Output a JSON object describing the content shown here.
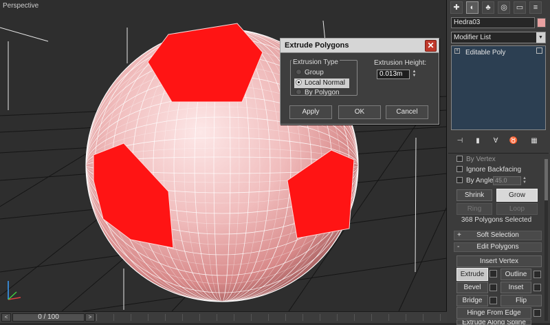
{
  "viewport": {
    "label": "Perspective"
  },
  "timeline": {
    "frame_text": "0 / 100",
    "prev_symbol": "<",
    "next_symbol": ">"
  },
  "dialog": {
    "title": "Extrude Polygons",
    "close_symbol": "✕",
    "extrusion_type_label": "Extrusion Type",
    "options": [
      "Group",
      "Local Normal",
      "By Polygon"
    ],
    "selected_option": "Local Normal",
    "extrusion_height_label": "Extrusion Height:",
    "extrusion_height_value": "0.013m",
    "buttons": {
      "apply": "Apply",
      "ok": "OK",
      "cancel": "Cancel"
    }
  },
  "panel": {
    "tabs": [
      "create-icon",
      "modify-icon",
      "hierarchy-icon",
      "motion-icon",
      "display-icon",
      "utilities-icon"
    ],
    "object_name": "Hedra03",
    "object_color": "#e8a0a0",
    "modifier_list_label": "Modifier List",
    "stack_items": [
      "Editable Poly"
    ],
    "selection": {
      "by_vertex_label": "By Vertex",
      "ignore_backfacing_label": "Ignore Backfacing",
      "by_angle_label": "By Angle:",
      "by_angle_value": "45.0",
      "shrink_label": "Shrink",
      "grow_label": "Grow",
      "ring_label": "Ring",
      "loop_label": "Loop",
      "selected_info": "368 Polygons Selected"
    },
    "soft_selection_label": "Soft Selection",
    "soft_selection_symbol": "+",
    "edit_polygons_label": "Edit Polygons",
    "edit_polygons_symbol": "-",
    "edit_buttons": {
      "insert_vertex": "Insert Vertex",
      "extrude": "Extrude",
      "outline": "Outline",
      "bevel": "Bevel",
      "inset": "Inset",
      "bridge": "Bridge",
      "flip": "Flip",
      "hinge_from_edge": "Hinge From Edge",
      "extrude_along_spline": "Extrude Along Spline"
    }
  },
  "colors": {
    "accent_red": "#ff1a1a",
    "ball_pink": "#f3c6c6",
    "viewport_bg": "#2e2e2e",
    "stack_bg": "#2c3f52"
  }
}
